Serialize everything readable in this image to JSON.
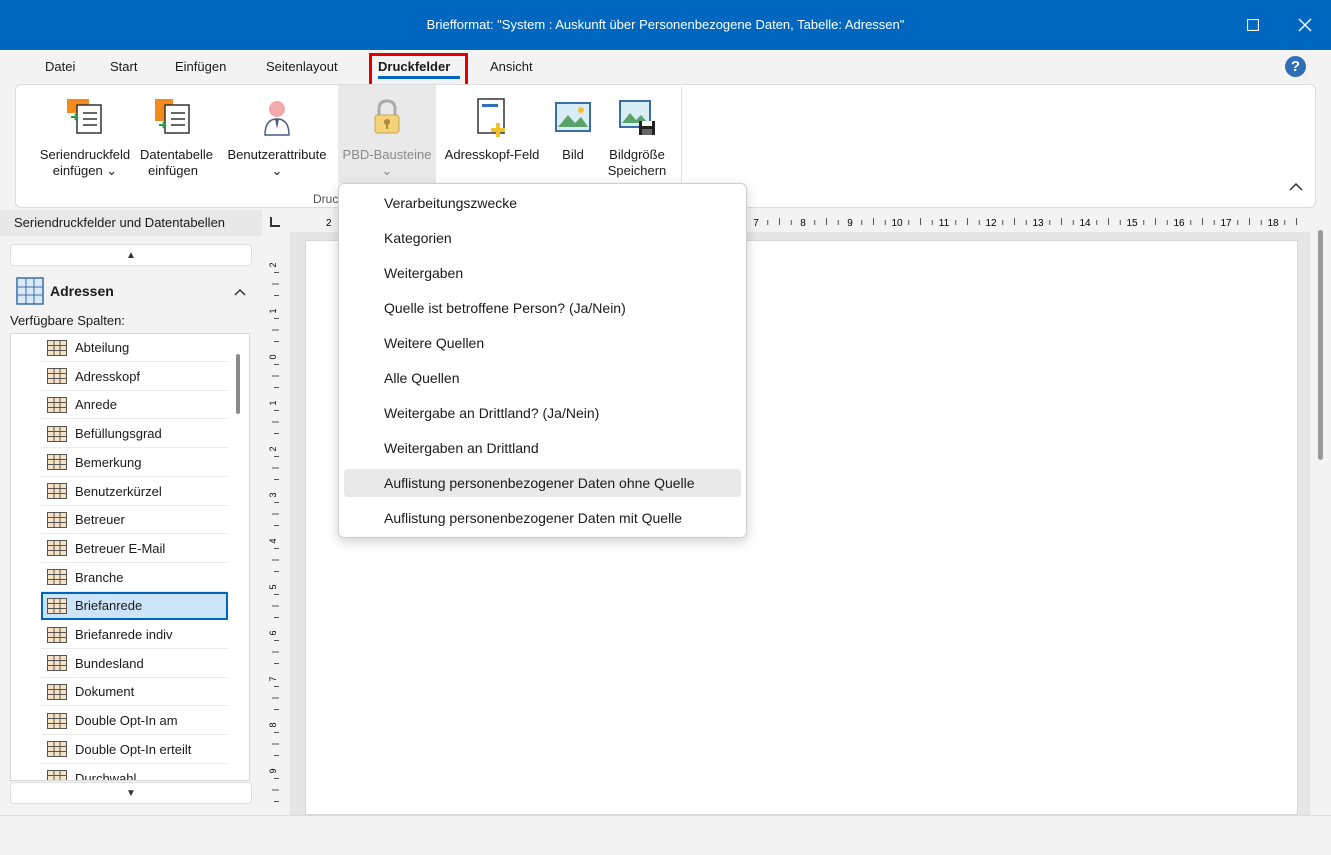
{
  "window": {
    "title": "Briefformat: \"System : Auskunft über Personenbezogene Daten, Tabelle: Adressen\""
  },
  "menu": {
    "tabs": [
      "Datei",
      "Start",
      "Einfügen",
      "Seitenlayout",
      "Druckfelder",
      "Ansicht"
    ],
    "active": "Druckfelder",
    "help": "?"
  },
  "ribbon": {
    "buttons": [
      {
        "label": "Seriendruckfeld einfügen ⌄",
        "icon": "merge-field-icon"
      },
      {
        "label": "Datentabelle einfügen",
        "icon": "data-table-icon"
      },
      {
        "label": "Benutzerattribute ⌄",
        "icon": "user-attribute-icon"
      },
      {
        "label": "PBD-Bausteine ⌄",
        "icon": "padlock-icon"
      },
      {
        "label": "Adresskopf-Feld",
        "icon": "address-header-icon"
      },
      {
        "label": "Bild",
        "icon": "image-icon"
      },
      {
        "label": "Bildgröße Speichern",
        "icon": "image-save-icon"
      }
    ],
    "group_label": "Druc"
  },
  "leftpane": {
    "header": "Seriendruckfelder und Datentabellen",
    "table_name": "Adressen",
    "available_label": "Verfügbare Spalten:",
    "columns": [
      "Abteilung",
      "Adresskopf",
      "Anrede",
      "Befüllungsgrad",
      "Bemerkung",
      "Benutzerkürzel",
      "Betreuer",
      "Betreuer E-Mail",
      "Branche",
      "Briefanrede",
      "Briefanrede indiv",
      "Bundesland",
      "Dokument",
      "Double Opt-In am",
      "Double Opt-In erteilt",
      "Durchwahl"
    ],
    "selected": "Briefanrede"
  },
  "ruler": {
    "left_visible": "2",
    "right_labels": [
      "7",
      "8",
      "9",
      "10",
      "11",
      "12",
      "13",
      "14",
      "15",
      "16",
      "17",
      "18"
    ],
    "vertical_labels": [
      "2",
      "1",
      "0",
      "1",
      "2",
      "3",
      "4",
      "5",
      "6",
      "7",
      "8",
      "9"
    ]
  },
  "dropdown": {
    "items": [
      "Verarbeitungszwecke",
      "Kategorien",
      "Weitergaben",
      "Quelle ist betroffene Person? (Ja/Nein)",
      "Weitere Quellen",
      "Alle Quellen",
      "Weitergabe an Drittland? (Ja/Nein)",
      "Weitergaben an Drittland",
      "Auflistung personenbezogener Daten ohne Quelle",
      "Auflistung personenbezogener Daten mit Quelle"
    ],
    "hovered": "Auflistung personenbezogener Daten ohne Quelle"
  },
  "colors": {
    "titlebar": "#0067c0",
    "highlight_box": "#e00000",
    "selected_row": "#cce4f7"
  }
}
